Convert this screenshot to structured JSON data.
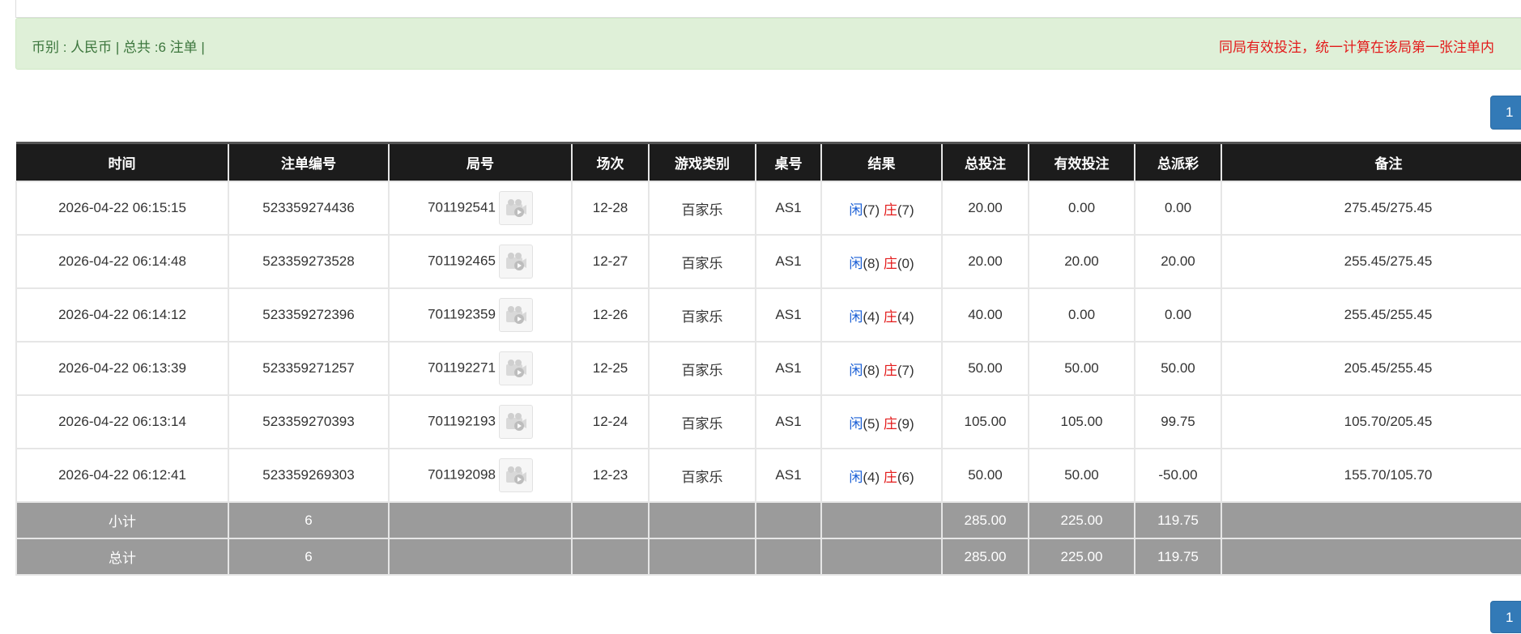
{
  "info_bar": {
    "summary": "币别 : 人民币 | 总共 :6 注单 |",
    "notice": "同局有效投注，统一计算在该局第一张注单内"
  },
  "pager": {
    "current_page": "1"
  },
  "table": {
    "columns": [
      "时间",
      "注单编号",
      "局号",
      "场次",
      "游戏类别",
      "桌号",
      "结果",
      "总投注",
      "有效投注",
      "总派彩",
      "备注"
    ],
    "rows": [
      {
        "time": "2026-04-22 06:15:15",
        "bet_id": "523359274436",
        "round": "701192541",
        "session": "12-28",
        "game": "百家乐",
        "table": "AS1",
        "player_label": "闲",
        "player_score": "(7)",
        "banker_label": "庄",
        "banker_score": "(7)",
        "total_bet": "20.00",
        "valid_bet": "0.00",
        "payout": "0.00",
        "payout_negative": false,
        "note": "275.45/275.45"
      },
      {
        "time": "2026-04-22 06:14:48",
        "bet_id": "523359273528",
        "round": "701192465",
        "session": "12-27",
        "game": "百家乐",
        "table": "AS1",
        "player_label": "闲",
        "player_score": "(8)",
        "banker_label": "庄",
        "banker_score": "(0)",
        "total_bet": "20.00",
        "valid_bet": "20.00",
        "payout": "20.00",
        "payout_negative": false,
        "note": "255.45/275.45"
      },
      {
        "time": "2026-04-22 06:14:12",
        "bet_id": "523359272396",
        "round": "701192359",
        "session": "12-26",
        "game": "百家乐",
        "table": "AS1",
        "player_label": "闲",
        "player_score": "(4)",
        "banker_label": "庄",
        "banker_score": "(4)",
        "total_bet": "40.00",
        "valid_bet": "0.00",
        "payout": "0.00",
        "payout_negative": false,
        "note": "255.45/255.45"
      },
      {
        "time": "2026-04-22 06:13:39",
        "bet_id": "523359271257",
        "round": "701192271",
        "session": "12-25",
        "game": "百家乐",
        "table": "AS1",
        "player_label": "闲",
        "player_score": "(8)",
        "banker_label": "庄",
        "banker_score": "(7)",
        "total_bet": "50.00",
        "valid_bet": "50.00",
        "payout": "50.00",
        "payout_negative": false,
        "note": "205.45/255.45"
      },
      {
        "time": "2026-04-22 06:13:14",
        "bet_id": "523359270393",
        "round": "701192193",
        "session": "12-24",
        "game": "百家乐",
        "table": "AS1",
        "player_label": "闲",
        "player_score": "(5)",
        "banker_label": "庄",
        "banker_score": "(9)",
        "total_bet": "105.00",
        "valid_bet": "105.00",
        "payout": "99.75",
        "payout_negative": false,
        "note": "105.70/205.45"
      },
      {
        "time": "2026-04-22 06:12:41",
        "bet_id": "523359269303",
        "round": "701192098",
        "session": "12-23",
        "game": "百家乐",
        "table": "AS1",
        "player_label": "闲",
        "player_score": "(4)",
        "banker_label": "庄",
        "banker_score": "(6)",
        "total_bet": "50.00",
        "valid_bet": "50.00",
        "payout": "-50.00",
        "payout_negative": true,
        "note": "155.70/105.70"
      }
    ],
    "subtotal": {
      "label": "小计",
      "count": "6",
      "total_bet": "285.00",
      "valid_bet": "225.00",
      "payout": "119.75"
    },
    "grand_total": {
      "label": "总计",
      "count": "6",
      "total_bet": "285.00",
      "valid_bet": "225.00",
      "payout": "119.75"
    }
  },
  "colors": {
    "header_bg": "#1c1c1c",
    "sum_bg": "#9b9b9b",
    "blue": "#1a5fd6",
    "red": "#e31b1b",
    "info_bg": "#dff0d8",
    "pager": "#337ab7"
  },
  "icons": {
    "replay": "video-replay-icon"
  }
}
